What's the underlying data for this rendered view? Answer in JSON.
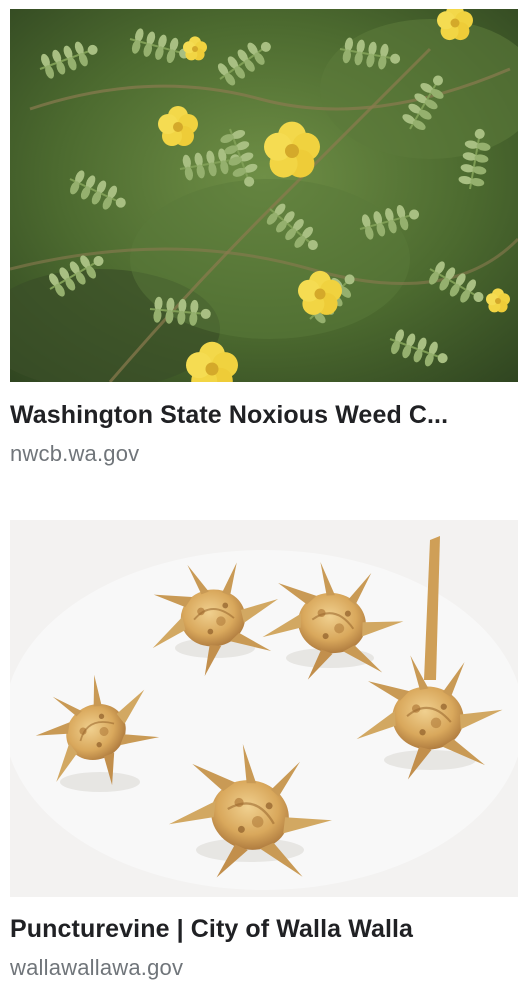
{
  "results": [
    {
      "title": "Washington State Noxious Weed C...",
      "source": "nwcb.wa.gov"
    },
    {
      "title": "Puncturevine | City of Walla Walla",
      "source": "wallawallawa.gov"
    }
  ]
}
